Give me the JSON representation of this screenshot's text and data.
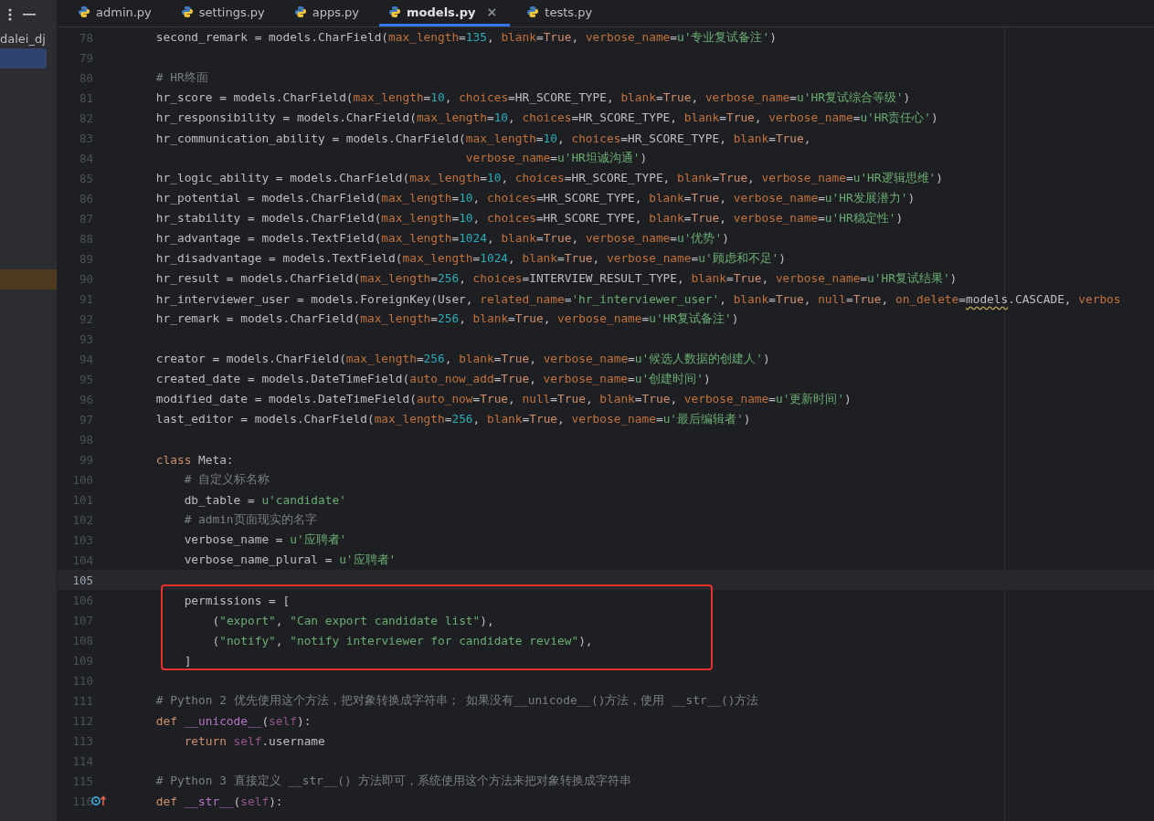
{
  "sidebar": {
    "rows": [
      {
        "label": "dalei_dj",
        "selected": false,
        "highlighted": false
      },
      {
        "selected": true,
        "highlighted": false
      },
      {
        "selected": false,
        "highlighted": false
      },
      {
        "selected": false,
        "highlighted": false
      },
      {
        "selected": false,
        "highlighted": false
      },
      {
        "selected": false,
        "highlighted": false
      },
      {
        "selected": false,
        "highlighted": false
      },
      {
        "selected": false,
        "highlighted": false
      },
      {
        "selected": false,
        "highlighted": false
      },
      {
        "selected": false,
        "highlighted": false
      },
      {
        "selected": false,
        "highlighted": false
      },
      {
        "selected": false,
        "highlighted": false
      },
      {
        "selected": false,
        "highlighted": true
      }
    ]
  },
  "tabs": [
    {
      "label": "admin.py",
      "selected": false
    },
    {
      "label": "settings.py",
      "selected": false
    },
    {
      "label": "apps.py",
      "selected": false
    },
    {
      "label": "models.py",
      "selected": true,
      "close": "×"
    },
    {
      "label": "tests.py",
      "selected": false
    }
  ],
  "editor": {
    "lines": [
      {
        "no": "78",
        "current": false,
        "boxed": false,
        "tokens": [
          "    second_remark = models.CharField(",
          {
            "kind": "param",
            "text": "max_length"
          },
          "=",
          {
            "kind": "num",
            "text": "135"
          },
          ", ",
          {
            "kind": "param",
            "text": "blank"
          },
          "=",
          {
            "kind": "kw",
            "text": "True"
          },
          ", ",
          {
            "kind": "param",
            "text": "verbose_name"
          },
          "=",
          {
            "kind": "str",
            "text": "u'专业复试备注'"
          },
          ")"
        ]
      },
      {
        "no": "79",
        "current": false,
        "boxed": false
      },
      {
        "no": "80",
        "current": false,
        "boxed": false,
        "tokens": [
          {
            "kind": "cmt",
            "text": "    # HR终面"
          }
        ]
      },
      {
        "no": "81",
        "current": false,
        "boxed": false,
        "tokens": [
          "    hr_score = models.CharField(",
          {
            "kind": "param",
            "text": "max_length"
          },
          "=",
          {
            "kind": "num",
            "text": "10"
          },
          ", ",
          {
            "kind": "param",
            "text": "choices"
          },
          "=HR_SCORE_TYPE, ",
          {
            "kind": "param",
            "text": "blank"
          },
          "=",
          {
            "kind": "kw",
            "text": "True"
          },
          ", ",
          {
            "kind": "param",
            "text": "verbose_name"
          },
          "=",
          {
            "kind": "str",
            "text": "u'HR复试综合等级'"
          },
          ")"
        ]
      },
      {
        "no": "82",
        "current": false,
        "boxed": false,
        "tokens": [
          "    hr_responsibility = models.CharField(",
          {
            "kind": "param",
            "text": "max_length"
          },
          "=",
          {
            "kind": "num",
            "text": "10"
          },
          ", ",
          {
            "kind": "param",
            "text": "choices"
          },
          "=HR_SCORE_TYPE, ",
          {
            "kind": "param",
            "text": "blank"
          },
          "=",
          {
            "kind": "kw",
            "text": "True"
          },
          ", ",
          {
            "kind": "param",
            "text": "verbose_name"
          },
          "=",
          {
            "kind": "str",
            "text": "u'HR责任心'"
          },
          ")"
        ]
      },
      {
        "no": "83",
        "current": false,
        "boxed": false,
        "tokens": [
          "    hr_communication_ability = models.CharField(",
          {
            "kind": "param",
            "text": "max_length"
          },
          "=",
          {
            "kind": "num",
            "text": "10"
          },
          ", ",
          {
            "kind": "param",
            "text": "choices"
          },
          "=HR_SCORE_TYPE, ",
          {
            "kind": "param",
            "text": "blank"
          },
          "=",
          {
            "kind": "kw",
            "text": "True"
          },
          ","
        ]
      },
      {
        "no": "84",
        "current": false,
        "boxed": false,
        "tokens": [
          {
            "kind": "param",
            "text": "                                                verbose_name"
          },
          "=",
          {
            "kind": "str",
            "text": "u'HR坦诚沟通'"
          },
          ")"
        ]
      },
      {
        "no": "85",
        "current": false,
        "boxed": false,
        "tokens": [
          "    hr_logic_ability = models.CharField(",
          {
            "kind": "param",
            "text": "max_length"
          },
          "=",
          {
            "kind": "num",
            "text": "10"
          },
          ", ",
          {
            "kind": "param",
            "text": "choices"
          },
          "=HR_SCORE_TYPE, ",
          {
            "kind": "param",
            "text": "blank"
          },
          "=",
          {
            "kind": "kw",
            "text": "True"
          },
          ", ",
          {
            "kind": "param",
            "text": "verbose_name"
          },
          "=",
          {
            "kind": "str",
            "text": "u'HR逻辑思维'"
          },
          ")"
        ]
      },
      {
        "no": "86",
        "current": false,
        "boxed": false,
        "tokens": [
          "    hr_potential = models.CharField(",
          {
            "kind": "param",
            "text": "max_length"
          },
          "=",
          {
            "kind": "num",
            "text": "10"
          },
          ", ",
          {
            "kind": "param",
            "text": "choices"
          },
          "=HR_SCORE_TYPE, ",
          {
            "kind": "param",
            "text": "blank"
          },
          "=",
          {
            "kind": "kw",
            "text": "True"
          },
          ", ",
          {
            "kind": "param",
            "text": "verbose_name"
          },
          "=",
          {
            "kind": "str",
            "text": "u'HR发展潜力'"
          },
          ")"
        ]
      },
      {
        "no": "87",
        "current": false,
        "boxed": false,
        "tokens": [
          "    hr_stability = models.CharField(",
          {
            "kind": "param",
            "text": "max_length"
          },
          "=",
          {
            "kind": "num",
            "text": "10"
          },
          ", ",
          {
            "kind": "param",
            "text": "choices"
          },
          "=HR_SCORE_TYPE, ",
          {
            "kind": "param",
            "text": "blank"
          },
          "=",
          {
            "kind": "kw",
            "text": "True"
          },
          ", ",
          {
            "kind": "param",
            "text": "verbose_name"
          },
          "=",
          {
            "kind": "str",
            "text": "u'HR稳定性'"
          },
          ")"
        ]
      },
      {
        "no": "88",
        "current": false,
        "boxed": false,
        "tokens": [
          "    hr_advantage = models.TextField(",
          {
            "kind": "param",
            "text": "max_length"
          },
          "=",
          {
            "kind": "num",
            "text": "1024"
          },
          ", ",
          {
            "kind": "param",
            "text": "blank"
          },
          "=",
          {
            "kind": "kw",
            "text": "True"
          },
          ", ",
          {
            "kind": "param",
            "text": "verbose_name"
          },
          "=",
          {
            "kind": "str",
            "text": "u'优势'"
          },
          ")"
        ]
      },
      {
        "no": "89",
        "current": false,
        "boxed": false,
        "tokens": [
          "    hr_disadvantage = models.TextField(",
          {
            "kind": "param",
            "text": "max_length"
          },
          "=",
          {
            "kind": "num",
            "text": "1024"
          },
          ", ",
          {
            "kind": "param",
            "text": "blank"
          },
          "=",
          {
            "kind": "kw",
            "text": "True"
          },
          ", ",
          {
            "kind": "param",
            "text": "verbose_name"
          },
          "=",
          {
            "kind": "str",
            "text": "u'顾虑和不足'"
          },
          ")"
        ]
      },
      {
        "no": "90",
        "current": false,
        "boxed": false,
        "tokens": [
          "    hr_result = models.CharField(",
          {
            "kind": "param",
            "text": "max_length"
          },
          "=",
          {
            "kind": "num",
            "text": "256"
          },
          ", ",
          {
            "kind": "param",
            "text": "choices"
          },
          "=INTERVIEW_RESULT_TYPE, ",
          {
            "kind": "param",
            "text": "blank"
          },
          "=",
          {
            "kind": "kw",
            "text": "True"
          },
          ", ",
          {
            "kind": "param",
            "text": "verbose_name"
          },
          "=",
          {
            "kind": "str",
            "text": "u'HR复试结果'"
          },
          ")"
        ]
      },
      {
        "no": "91",
        "current": false,
        "boxed": false,
        "tokens": [
          "    hr_interviewer_user = models.ForeignKey(User, ",
          {
            "kind": "param",
            "text": "related_name"
          },
          "=",
          {
            "kind": "str",
            "text": "'hr_interviewer_user'"
          },
          ", ",
          {
            "kind": "param",
            "text": "blank"
          },
          "=",
          {
            "kind": "kw",
            "text": "True"
          },
          ", ",
          {
            "kind": "param",
            "text": "null"
          },
          "=",
          {
            "kind": "kw",
            "text": "True"
          },
          ", ",
          {
            "kind": "param",
            "text": "on_delete"
          },
          "=",
          {
            "kind": "warn",
            "text": "models"
          },
          ".CASCADE, ",
          {
            "kind": "param",
            "text": "verbos"
          }
        ]
      },
      {
        "no": "92",
        "current": false,
        "boxed": false,
        "tokens": [
          "    hr_remark = models.CharField(",
          {
            "kind": "param",
            "text": "max_length"
          },
          "=",
          {
            "kind": "num",
            "text": "256"
          },
          ", ",
          {
            "kind": "param",
            "text": "blank"
          },
          "=",
          {
            "kind": "kw",
            "text": "True"
          },
          ", ",
          {
            "kind": "param",
            "text": "verbose_name"
          },
          "=",
          {
            "kind": "str",
            "text": "u'HR复试备注'"
          },
          ")"
        ]
      },
      {
        "no": "93",
        "current": false,
        "boxed": false
      },
      {
        "no": "94",
        "current": false,
        "boxed": false,
        "tokens": [
          "    creator = models.CharField(",
          {
            "kind": "param",
            "text": "max_length"
          },
          "=",
          {
            "kind": "num",
            "text": "256"
          },
          ", ",
          {
            "kind": "param",
            "text": "blank"
          },
          "=",
          {
            "kind": "kw",
            "text": "True"
          },
          ", ",
          {
            "kind": "param",
            "text": "verbose_name"
          },
          "=",
          {
            "kind": "str",
            "text": "u'候选人数据的创建人'"
          },
          ")"
        ]
      },
      {
        "no": "95",
        "current": false,
        "boxed": false,
        "tokens": [
          "    created_date = models.DateTimeField(",
          {
            "kind": "param",
            "text": "auto_now_add"
          },
          "=",
          {
            "kind": "kw",
            "text": "True"
          },
          ", ",
          {
            "kind": "param",
            "text": "verbose_name"
          },
          "=",
          {
            "kind": "str",
            "text": "u'创建时间'"
          },
          ")"
        ]
      },
      {
        "no": "96",
        "current": false,
        "boxed": false,
        "tokens": [
          "    modified_date = models.DateTimeField(",
          {
            "kind": "param",
            "text": "auto_now"
          },
          "=",
          {
            "kind": "kw",
            "text": "True"
          },
          ", ",
          {
            "kind": "param",
            "text": "null"
          },
          "=",
          {
            "kind": "kw",
            "text": "True"
          },
          ", ",
          {
            "kind": "param",
            "text": "blank"
          },
          "=",
          {
            "kind": "kw",
            "text": "True"
          },
          ", ",
          {
            "kind": "param",
            "text": "verbose_name"
          },
          "=",
          {
            "kind": "str",
            "text": "u'更新时间'"
          },
          ")"
        ]
      },
      {
        "no": "97",
        "current": false,
        "boxed": false,
        "tokens": [
          "    last_editor = models.CharField(",
          {
            "kind": "param",
            "text": "max_length"
          },
          "=",
          {
            "kind": "num",
            "text": "256"
          },
          ", ",
          {
            "kind": "param",
            "text": "blank"
          },
          "=",
          {
            "kind": "kw",
            "text": "True"
          },
          ", ",
          {
            "kind": "param",
            "text": "verbose_name"
          },
          "=",
          {
            "kind": "str",
            "text": "u'最后编辑者'"
          },
          ")"
        ]
      },
      {
        "no": "98",
        "current": false,
        "boxed": false
      },
      {
        "no": "99",
        "current": false,
        "boxed": false,
        "tokens": [
          {
            "kind": "kw",
            "text": "    class"
          },
          " Meta:"
        ]
      },
      {
        "no": "100",
        "current": false,
        "boxed": false,
        "tokens": [
          {
            "kind": "cmt",
            "text": "        # 自定义标名称"
          }
        ]
      },
      {
        "no": "101",
        "current": false,
        "boxed": false,
        "tokens": [
          "        db_table = ",
          {
            "kind": "str",
            "text": "u'candidate'"
          }
        ]
      },
      {
        "no": "102",
        "current": false,
        "boxed": false,
        "tokens": [
          {
            "kind": "cmt",
            "text": "        # admin页面现实的名字"
          }
        ]
      },
      {
        "no": "103",
        "current": false,
        "boxed": false,
        "tokens": [
          "        verbose_name = ",
          {
            "kind": "str",
            "text": "u'应聘者'"
          }
        ]
      },
      {
        "no": "104",
        "current": false,
        "boxed": false,
        "tokens": [
          "        verbose_name_plural = ",
          {
            "kind": "str",
            "text": "u'应聘者'"
          }
        ]
      },
      {
        "no": "105",
        "current": true,
        "boxed": false
      },
      {
        "no": "106",
        "current": false,
        "boxed": true,
        "tokens": [
          "        permissions = ["
        ]
      },
      {
        "no": "107",
        "current": false,
        "boxed": true,
        "tokens": [
          "            (",
          {
            "kind": "str",
            "text": "\"export\""
          },
          ", ",
          {
            "kind": "str",
            "text": "\"Can export candidate list\""
          },
          "),"
        ]
      },
      {
        "no": "108",
        "current": false,
        "boxed": true,
        "tokens": [
          "            (",
          {
            "kind": "str",
            "text": "\"notify\""
          },
          ", ",
          {
            "kind": "str",
            "text": "\"notify interviewer for candidate review\""
          },
          "),"
        ]
      },
      {
        "no": "109",
        "current": false,
        "boxed": true,
        "tokens": [
          "        ]"
        ]
      },
      {
        "no": "110",
        "current": false,
        "boxed": false
      },
      {
        "no": "111",
        "current": false,
        "boxed": false,
        "tokens": [
          {
            "kind": "cmt",
            "text": "    # Python 2 优先使用这个方法，把对象转换成字符串； 如果没有__unicode__()方法，使用 __str__()方法"
          }
        ]
      },
      {
        "no": "112",
        "current": false,
        "boxed": false,
        "tokens": [
          {
            "kind": "kw",
            "text": "    def "
          },
          {
            "kind": "magic",
            "text": "__unicode__"
          },
          "(",
          {
            "kind": "self",
            "text": "self"
          },
          "):"
        ]
      },
      {
        "no": "113",
        "current": false,
        "boxed": false,
        "tokens": [
          {
            "kind": "kw",
            "text": "        return "
          },
          {
            "kind": "self",
            "text": "self"
          },
          ".username"
        ]
      },
      {
        "no": "114",
        "current": false,
        "boxed": false
      },
      {
        "no": "115",
        "current": false,
        "boxed": false,
        "tokens": [
          {
            "kind": "cmt",
            "text": "    # Python 3 直接定义 __str__() 方法即可，系统使用这个方法来把对象转换成字符串"
          }
        ]
      },
      {
        "no": "116",
        "current": false,
        "boxed": false,
        "override_marker": true,
        "tokens": [
          {
            "kind": "kw",
            "text": "    def "
          },
          {
            "kind": "magic",
            "text": "__str__"
          },
          "(",
          {
            "kind": "self",
            "text": "self"
          },
          "):"
        ]
      }
    ]
  }
}
